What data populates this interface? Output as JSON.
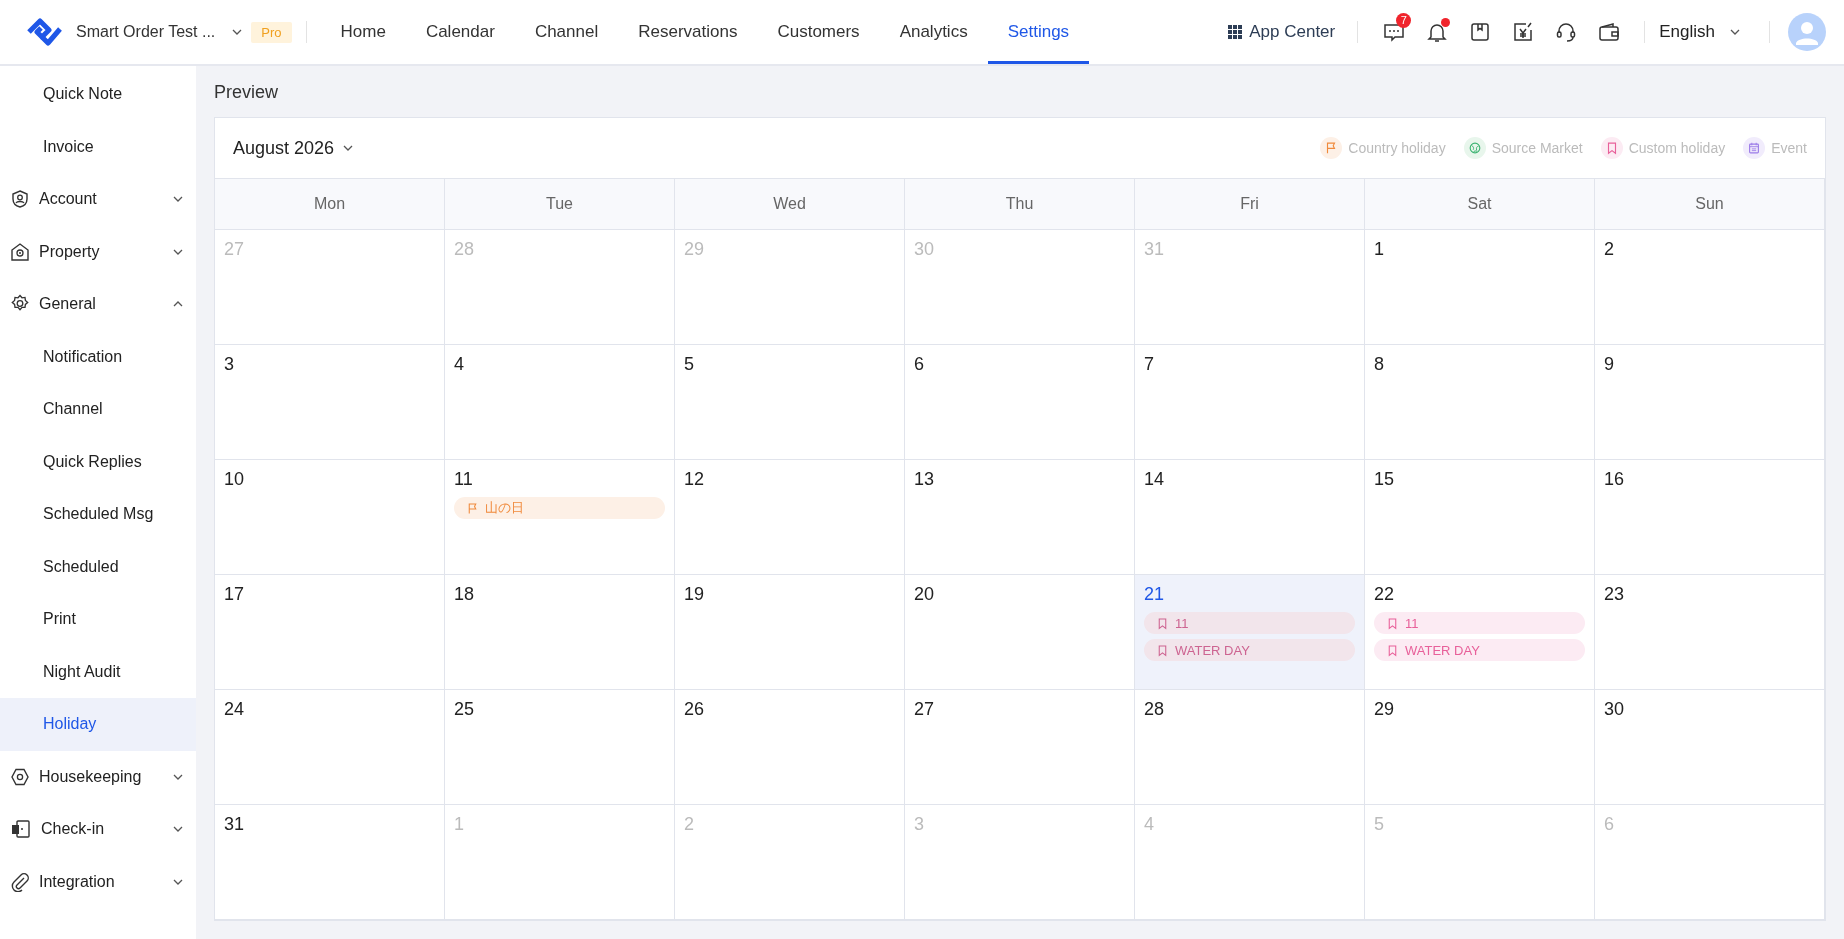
{
  "header": {
    "property": "Smart Order Test ...",
    "plan": "Pro",
    "tabs": [
      {
        "label": "Home",
        "selected": false
      },
      {
        "label": "Calendar",
        "selected": false
      },
      {
        "label": "Channel",
        "selected": false
      },
      {
        "label": "Reservations",
        "selected": false
      },
      {
        "label": "Customers",
        "selected": false
      },
      {
        "label": "Analytics",
        "selected": false
      },
      {
        "label": "Settings",
        "selected": true
      }
    ],
    "app_center": "App Center",
    "message_count": "7",
    "bell_dot": true,
    "language": "English"
  },
  "sidebar": {
    "items": [
      {
        "label": "Quick Note",
        "kind": "child",
        "selected": false
      },
      {
        "label": "Invoice",
        "kind": "child",
        "selected": false
      },
      {
        "label": "Account",
        "kind": "group",
        "expanded": false
      },
      {
        "label": "Property",
        "kind": "group",
        "expanded": false
      },
      {
        "label": "General",
        "kind": "group",
        "expanded": true,
        "children": [
          {
            "label": "Notification",
            "selected": false
          },
          {
            "label": "Channel",
            "selected": false
          },
          {
            "label": "Quick Replies",
            "selected": false
          },
          {
            "label": "Scheduled Msg",
            "selected": false
          },
          {
            "label": "Scheduled",
            "selected": false
          },
          {
            "label": "Print",
            "selected": false
          },
          {
            "label": "Night Audit",
            "selected": false
          },
          {
            "label": "Holiday",
            "selected": true
          }
        ]
      },
      {
        "label": "Housekeeping",
        "kind": "group",
        "expanded": false
      },
      {
        "label": "Check-in",
        "kind": "group",
        "expanded": false
      },
      {
        "label": "Integration",
        "kind": "group",
        "expanded": false
      }
    ]
  },
  "preview": {
    "title": "Preview",
    "month": "August 2026",
    "legend": [
      {
        "label": "Country holiday",
        "kind": "country"
      },
      {
        "label": "Source Market",
        "kind": "market"
      },
      {
        "label": "Custom holiday",
        "kind": "custom"
      },
      {
        "label": "Event",
        "kind": "event"
      }
    ],
    "weekdays": [
      "Mon",
      "Tue",
      "Wed",
      "Thu",
      "Fri",
      "Sat",
      "Sun"
    ],
    "days": [
      {
        "day": "27",
        "other_month": true,
        "selected": false
      },
      {
        "day": "28",
        "other_month": true,
        "selected": false
      },
      {
        "day": "29",
        "other_month": true,
        "selected": false
      },
      {
        "day": "30",
        "other_month": true,
        "selected": false
      },
      {
        "day": "31",
        "other_month": true,
        "selected": false
      },
      {
        "day": "1",
        "other_month": false,
        "selected": false
      },
      {
        "day": "2",
        "other_month": false,
        "selected": false
      },
      {
        "day": "3",
        "other_month": false,
        "selected": false
      },
      {
        "day": "4",
        "other_month": false,
        "selected": false
      },
      {
        "day": "5",
        "other_month": false,
        "selected": false
      },
      {
        "day": "6",
        "other_month": false,
        "selected": false
      },
      {
        "day": "7",
        "other_month": false,
        "selected": false
      },
      {
        "day": "8",
        "other_month": false,
        "selected": false
      },
      {
        "day": "9",
        "other_month": false,
        "selected": false
      },
      {
        "day": "10",
        "other_month": false,
        "selected": false
      },
      {
        "day": "11",
        "other_month": false,
        "selected": false,
        "events": [
          {
            "label": "山の日",
            "kind": "country"
          }
        ]
      },
      {
        "day": "12",
        "other_month": false,
        "selected": false
      },
      {
        "day": "13",
        "other_month": false,
        "selected": false
      },
      {
        "day": "14",
        "other_month": false,
        "selected": false
      },
      {
        "day": "15",
        "other_month": false,
        "selected": false
      },
      {
        "day": "16",
        "other_month": false,
        "selected": false
      },
      {
        "day": "17",
        "other_month": false,
        "selected": false
      },
      {
        "day": "18",
        "other_month": false,
        "selected": false
      },
      {
        "day": "19",
        "other_month": false,
        "selected": false
      },
      {
        "day": "20",
        "other_month": false,
        "selected": false
      },
      {
        "day": "21",
        "other_month": false,
        "selected": true,
        "events": [
          {
            "label": "11",
            "kind": "custom"
          },
          {
            "label": "WATER DAY",
            "kind": "custom"
          }
        ]
      },
      {
        "day": "22",
        "other_month": false,
        "selected": false,
        "events": [
          {
            "label": "11",
            "kind": "custom"
          },
          {
            "label": "WATER DAY",
            "kind": "custom"
          }
        ]
      },
      {
        "day": "23",
        "other_month": false,
        "selected": false
      },
      {
        "day": "24",
        "other_month": false,
        "selected": false
      },
      {
        "day": "25",
        "other_month": false,
        "selected": false
      },
      {
        "day": "26",
        "other_month": false,
        "selected": false
      },
      {
        "day": "27",
        "other_month": false,
        "selected": false
      },
      {
        "day": "28",
        "other_month": false,
        "selected": false
      },
      {
        "day": "29",
        "other_month": false,
        "selected": false
      },
      {
        "day": "30",
        "other_month": false,
        "selected": false
      },
      {
        "day": "31",
        "other_month": false,
        "selected": false
      },
      {
        "day": "1",
        "other_month": true,
        "selected": false
      },
      {
        "day": "2",
        "other_month": true,
        "selected": false
      },
      {
        "day": "3",
        "other_month": true,
        "selected": false
      },
      {
        "day": "4",
        "other_month": true,
        "selected": false
      },
      {
        "day": "5",
        "other_month": true,
        "selected": false
      },
      {
        "day": "6",
        "other_month": true,
        "selected": false
      }
    ]
  }
}
